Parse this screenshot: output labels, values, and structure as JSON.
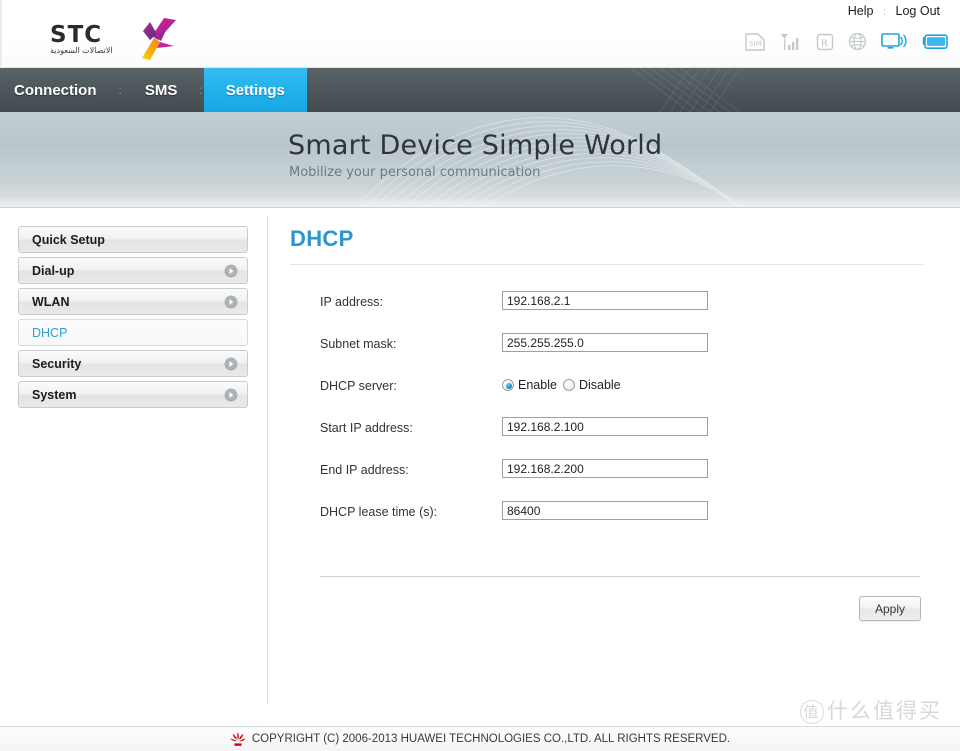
{
  "header": {
    "brand_text": "STC",
    "brand_sub": "الاتصالات السعودية",
    "links": [
      {
        "label": "Help"
      },
      {
        "label": "Log Out"
      }
    ],
    "link_separator": ":",
    "status_icons": [
      {
        "name": "sim-icon",
        "label": "SIM",
        "state": "inactive"
      },
      {
        "name": "signal-icon",
        "label": "Signal",
        "state": "inactive"
      },
      {
        "name": "roaming-icon",
        "label": "R",
        "state": "inactive"
      },
      {
        "name": "globe-icon",
        "label": "Internet",
        "state": "inactive"
      },
      {
        "name": "wifi-monitor-icon",
        "label": "WLAN",
        "state": "active"
      },
      {
        "name": "battery-icon",
        "label": "Battery",
        "state": "active"
      }
    ]
  },
  "nav": {
    "items": [
      {
        "label": "Connection",
        "active": false
      },
      {
        "label": "SMS",
        "active": false
      },
      {
        "label": "Settings",
        "active": true
      }
    ],
    "separator": ":"
  },
  "banner": {
    "title": "Smart Device   Simple World",
    "subtitle": "Mobilize your personal communication"
  },
  "sidebar": {
    "items": [
      {
        "label": "Quick Setup",
        "has_arrow": false,
        "active": false
      },
      {
        "label": "Dial-up",
        "has_arrow": true,
        "active": false
      },
      {
        "label": "WLAN",
        "has_arrow": true,
        "active": false
      },
      {
        "label": "DHCP",
        "has_arrow": false,
        "active": true
      },
      {
        "label": "Security",
        "has_arrow": true,
        "active": false
      },
      {
        "label": "System",
        "has_arrow": true,
        "active": false
      }
    ]
  },
  "panel": {
    "title": "DHCP",
    "fields": [
      {
        "label": "IP address:",
        "type": "text",
        "value": "192.168.2.1"
      },
      {
        "label": "Subnet mask:",
        "type": "text",
        "value": "255.255.255.0"
      },
      {
        "label": "DHCP server:",
        "type": "radio",
        "options": [
          {
            "label": "Enable",
            "checked": true
          },
          {
            "label": "Disable",
            "checked": false
          }
        ]
      },
      {
        "label": "Start IP address:",
        "type": "text",
        "value": "192.168.2.100"
      },
      {
        "label": "End IP address:",
        "type": "text",
        "value": "192.168.2.200"
      },
      {
        "label": "DHCP lease time (s):",
        "type": "text",
        "value": "86400"
      }
    ],
    "apply_label": "Apply"
  },
  "footer": {
    "copyright": "COPYRIGHT (C) 2006-2013 HUAWEI TECHNOLOGIES CO.,LTD. ALL RIGHTS RESERVED.",
    "logo_name": "huawei-flower-logo"
  },
  "watermark": {
    "badge": "值",
    "text": "什么值得买"
  },
  "colors": {
    "accent_blue": "#21b2ec",
    "title_blue": "#2b97cc",
    "nav_dark": "#4e585c",
    "banner_grey": "#bfcbcf"
  }
}
